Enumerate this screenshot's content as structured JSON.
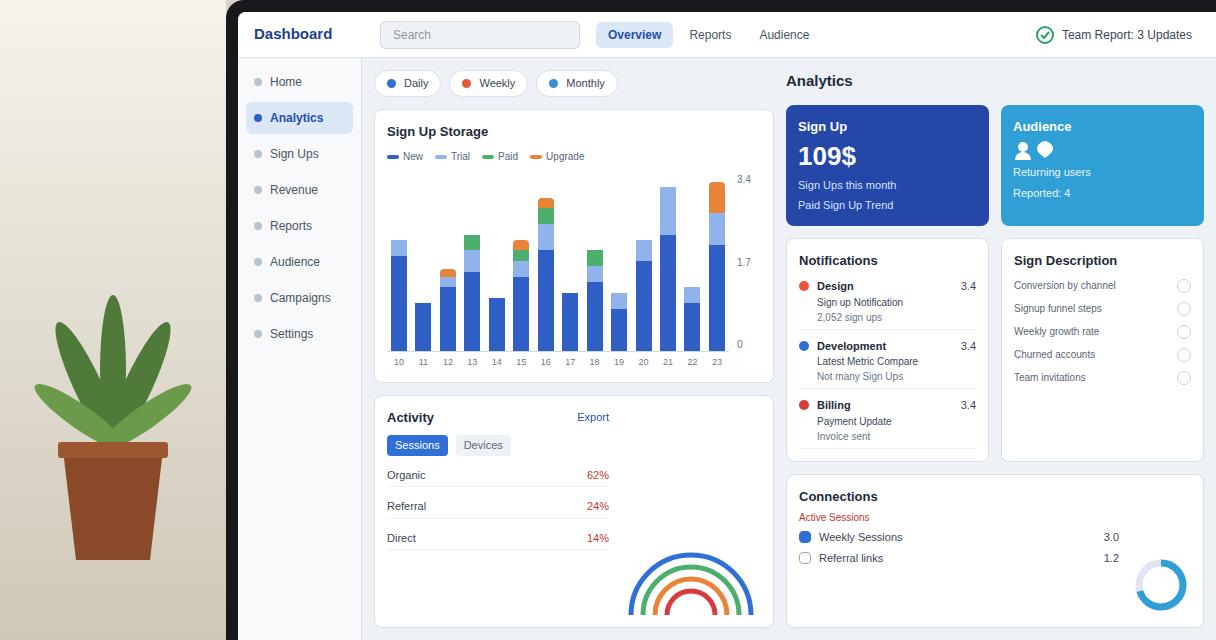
{
  "topbar": {
    "brand": "Dashboard",
    "search_placeholder": "Search",
    "status": "Team Report: 3 Updates",
    "tabs": [
      {
        "label": "Overview",
        "selected": true
      },
      {
        "label": "Reports",
        "selected": false
      },
      {
        "label": "Audience",
        "selected": false
      }
    ]
  },
  "sidebar": {
    "items": [
      {
        "label": "Home",
        "selected": false
      },
      {
        "label": "Analytics",
        "selected": true
      },
      {
        "label": "Sign Ups",
        "selected": false
      },
      {
        "label": "Revenue",
        "selected": false
      },
      {
        "label": "Reports",
        "selected": false
      },
      {
        "label": "Audience",
        "selected": false
      },
      {
        "label": "Campaigns",
        "selected": false
      },
      {
        "label": "Settings",
        "selected": false
      }
    ]
  },
  "filters": [
    {
      "label": "Daily",
      "color": "#2f6fd6"
    },
    {
      "label": "Weekly",
      "color": "#e8553a"
    },
    {
      "label": "Monthly",
      "color": "#3a8ed6"
    }
  ],
  "chart": {
    "title": "Sign Up Storage",
    "legend": [
      {
        "label": "New",
        "color": "#2f5fc4"
      },
      {
        "label": "Trial",
        "color": "#8fb3ea"
      },
      {
        "label": "Paid",
        "color": "#4caf6e"
      },
      {
        "label": "Upgrade",
        "color": "#e8833a"
      }
    ],
    "ticks": [
      "3.4",
      "1.7",
      "0"
    ],
    "x_labels": [
      "10",
      "11",
      "12",
      "13",
      "14",
      "15",
      "16",
      "17",
      "18",
      "19",
      "20",
      "21",
      "22",
      "23"
    ],
    "series": [
      {
        "name": "New",
        "color": "#2f5fc4",
        "values": [
          1.8,
          0.9,
          1.2,
          1.5,
          1.0,
          1.4,
          1.9,
          1.1,
          1.3,
          0.8,
          1.7,
          2.2,
          0.9,
          2.0
        ]
      },
      {
        "name": "Trial",
        "color": "#8fb3ea",
        "values": [
          0.3,
          0,
          0.2,
          0.4,
          0,
          0.3,
          0.5,
          0,
          0.3,
          0.3,
          0.4,
          0.9,
          0.3,
          0.6
        ]
      },
      {
        "name": "Paid",
        "color": "#4caf6e",
        "values": [
          0,
          0,
          0,
          0.3,
          0,
          0.2,
          0.3,
          0,
          0.3,
          0,
          0,
          0,
          0,
          0
        ]
      },
      {
        "name": "Upgrade",
        "color": "#e8833a",
        "values": [
          0,
          0,
          0.15,
          0,
          0,
          0.2,
          0.2,
          0,
          0,
          0,
          0,
          0,
          0,
          0.6
        ]
      }
    ]
  },
  "activity": {
    "title": "Activity",
    "export": "Export",
    "tabs": [
      {
        "label": "Sessions",
        "selected": true
      },
      {
        "label": "Devices",
        "selected": false
      }
    ],
    "rows": [
      {
        "label": "Organic",
        "value": "62%"
      },
      {
        "label": "Referral",
        "value": "24%"
      },
      {
        "label": "Direct",
        "value": "14%"
      }
    ]
  },
  "analytics": {
    "title": "Analytics",
    "signup": {
      "title": "Sign Up",
      "value": "109$",
      "caption": "Sign Ups this month",
      "note": "Paid Sign Up Trend"
    },
    "audience": {
      "title": "Audience",
      "lines": [
        "Returning users",
        "Reported: 4"
      ]
    }
  },
  "notifications": {
    "title": "Notifications",
    "items": [
      {
        "label": "Design",
        "text": "Sign up Notification",
        "sub": "2,052 sign ups",
        "value": "3.4",
        "color": "#e8553a"
      },
      {
        "label": "Development",
        "text": "Latest Metric Compare",
        "sub": "Not many Sign Ups",
        "value": "3.4",
        "color": "#2f6fd6"
      },
      {
        "label": "Billing",
        "text": "Payment Update",
        "sub": "Invoice sent",
        "value": "3.4",
        "color": "#d93a3a"
      }
    ]
  },
  "description": {
    "title": "Sign Description",
    "rows": [
      "Conversion by channel",
      "Signup funnel steps",
      "Weekly growth rate",
      "Churned accounts",
      "Team invitations"
    ]
  },
  "connections": {
    "title": "Connections",
    "subtitle": "Active Sessions",
    "level": 0.7,
    "items": [
      {
        "label": "Weekly Sessions",
        "checked": true,
        "value": "3.0"
      },
      {
        "label": "Referral links",
        "checked": false,
        "value": "1.2"
      }
    ]
  }
}
